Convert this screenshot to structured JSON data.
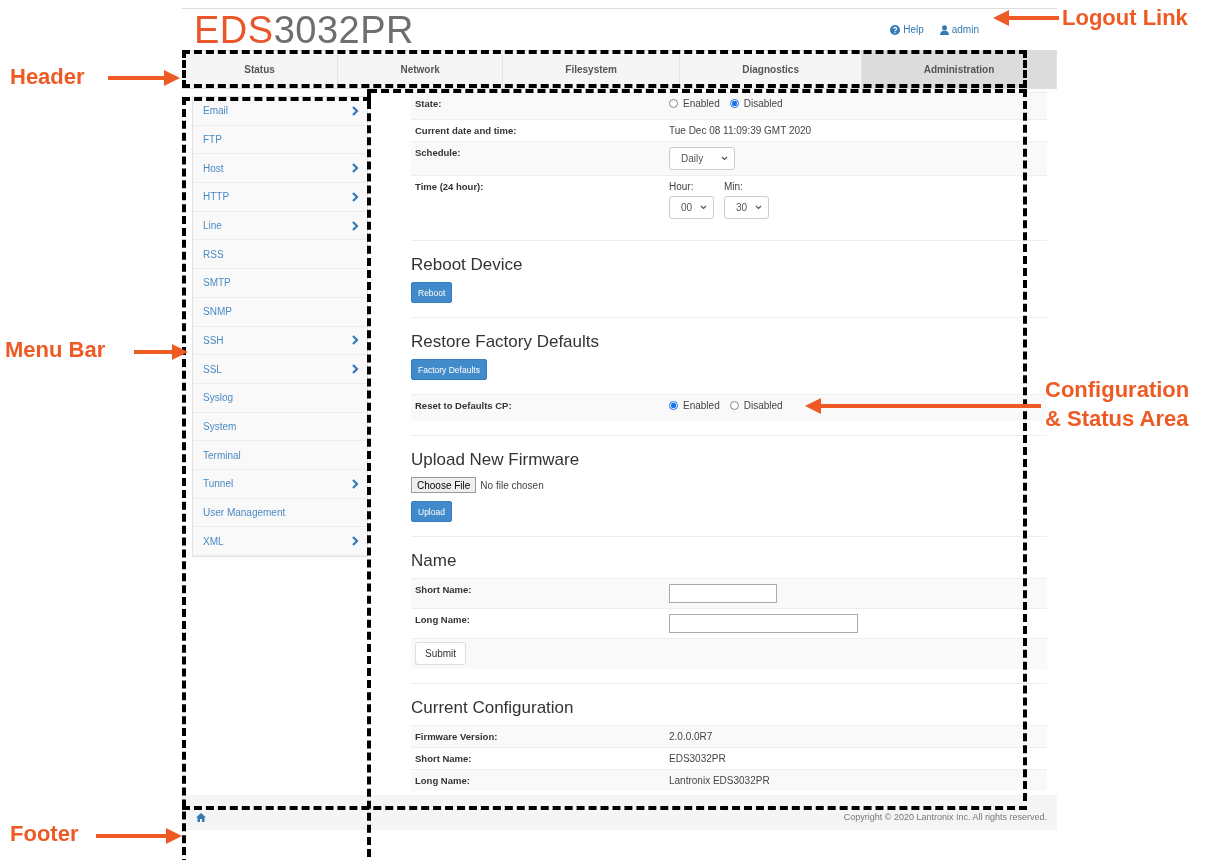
{
  "logo": {
    "prefix": "EDS",
    "suffix": "3032PR"
  },
  "top_links": [
    {
      "kind": "help",
      "label": "Help"
    },
    {
      "kind": "user",
      "label": "admin"
    }
  ],
  "tabs": [
    {
      "label": "Status",
      "selected": false
    },
    {
      "label": "Network",
      "selected": false
    },
    {
      "label": "Filesystem",
      "selected": false
    },
    {
      "label": "Diagnostics",
      "selected": false
    },
    {
      "label": "Administration",
      "selected": true
    }
  ],
  "sidebar": {
    "items": [
      {
        "label": "Email",
        "has_submenu": true
      },
      {
        "label": "FTP",
        "has_submenu": false
      },
      {
        "label": "Host",
        "has_submenu": true
      },
      {
        "label": "HTTP",
        "has_submenu": true
      },
      {
        "label": "Line",
        "has_submenu": true
      },
      {
        "label": "RSS",
        "has_submenu": false
      },
      {
        "label": "SMTP",
        "has_submenu": false
      },
      {
        "label": "SNMP",
        "has_submenu": false
      },
      {
        "label": "SSH",
        "has_submenu": true
      },
      {
        "label": "SSL",
        "has_submenu": true
      },
      {
        "label": "Syslog",
        "has_submenu": false
      },
      {
        "label": "System",
        "has_submenu": false
      },
      {
        "label": "Terminal",
        "has_submenu": false
      },
      {
        "label": "Tunnel",
        "has_submenu": true
      },
      {
        "label": "User Management",
        "has_submenu": false
      },
      {
        "label": "XML",
        "has_submenu": true
      }
    ]
  },
  "sections": [
    {
      "items": [
        {
          "kind": "table",
          "rows": [
            {
              "kind": "radio",
              "label": "State:",
              "options": [
                {
                  "label": "Enabled",
                  "selected": false
                },
                {
                  "label": "Disabled",
                  "selected": true
                }
              ]
            },
            {
              "kind": "text",
              "label": "Current date and time:",
              "value": "Tue Dec 08 11:09:39 GMT 2020"
            },
            {
              "kind": "select",
              "label": "Schedule:",
              "value": "Daily"
            },
            {
              "kind": "time",
              "label": "Time (24 hour):",
              "fields": [
                {
                  "label": "Hour:",
                  "value": "00"
                },
                {
                  "label": "Min:",
                  "value": "30"
                }
              ]
            }
          ]
        }
      ]
    },
    {
      "title": "Reboot Device",
      "items": [
        {
          "kind": "primary-button",
          "label": "Reboot"
        }
      ]
    },
    {
      "title": "Restore Factory Defaults",
      "items": [
        {
          "kind": "primary-button",
          "label": "Factory Defaults"
        },
        {
          "kind": "table",
          "rows": [
            {
              "kind": "radio",
              "label": "Reset to Defaults CP:",
              "options": [
                {
                  "label": "Enabled",
                  "selected": true
                },
                {
                  "label": "Disabled",
                  "selected": false
                }
              ]
            }
          ]
        }
      ]
    },
    {
      "title": "Upload New Firmware",
      "items": [
        {
          "kind": "file-picker",
          "button": "Choose File",
          "status": "No file chosen"
        },
        {
          "kind": "primary-button",
          "label": "Upload"
        }
      ]
    },
    {
      "title": "Name",
      "items": [
        {
          "kind": "table",
          "rows": [
            {
              "kind": "short-input",
              "label": "Short Name:"
            },
            {
              "kind": "long-input",
              "label": "Long Name:"
            },
            {
              "kind": "submit",
              "label": "Submit"
            }
          ]
        }
      ]
    },
    {
      "title": "Current Configuration",
      "items": [
        {
          "kind": "table",
          "rows": [
            {
              "kind": "text",
              "label": "Firmware Version:",
              "value": "2.0.0.0R7"
            },
            {
              "kind": "text",
              "label": "Short Name:",
              "value": "EDS3032PR"
            },
            {
              "kind": "text",
              "label": "Long Name:",
              "value": "Lantronix EDS3032PR"
            }
          ]
        }
      ]
    }
  ],
  "footer": {
    "copyright": "Copyright © 2020 Lantronix Inc. All rights reserved."
  },
  "annotations": [
    {
      "kind": "logout",
      "lines": [
        "Logout Link"
      ]
    },
    {
      "kind": "header",
      "lines": [
        "Header"
      ]
    },
    {
      "kind": "menu",
      "lines": [
        "Menu Bar"
      ]
    },
    {
      "kind": "config",
      "lines": [
        "Configuration",
        "& Status Area"
      ]
    },
    {
      "kind": "footer",
      "lines": [
        "Footer"
      ]
    }
  ]
}
